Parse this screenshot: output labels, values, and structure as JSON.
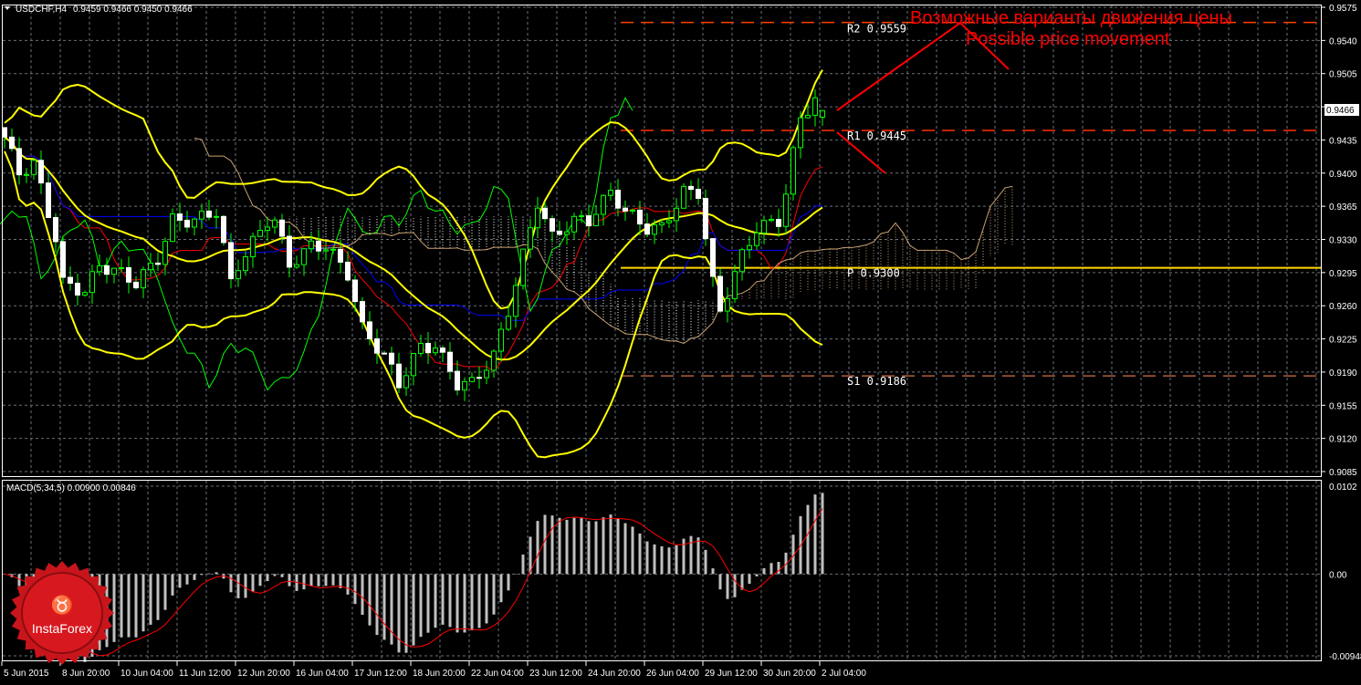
{
  "header": {
    "symbol": "USDCHF,H4",
    "ohlc": "0.9459 0.9466 0.9450 0.9466"
  },
  "macd_header": "MACD(5,34,5) 0.00900 0.00846",
  "price_axis": [
    "0.9575",
    "0.9540",
    "0.9505",
    "0.9470",
    "0.9435",
    "0.9400",
    "0.9365",
    "0.9330",
    "0.9295",
    "0.9260",
    "0.9225",
    "0.9190",
    "0.9155",
    "0.9120",
    "0.9085"
  ],
  "current_price": "0.9466",
  "macd_axis": [
    "0.0102",
    "0.00",
    "-0.00948"
  ],
  "time_axis": [
    "5 Jun 2015",
    "8 Jun 20:00",
    "10 Jun 04:00",
    "11 Jun 12:00",
    "12 Jun 20:00",
    "16 Jun 04:00",
    "17 Jun 12:00",
    "18 Jun 20:00",
    "22 Jun 04:00",
    "23 Jun 12:00",
    "24 Jun 20:00",
    "26 Jun 04:00",
    "29 Jun 12:00",
    "30 Jun 20:00",
    "2 Jul 04:00"
  ],
  "levels": [
    {
      "label": "R2 0.9559",
      "price": 0.9559,
      "color": "#ff4000",
      "style": "dashed"
    },
    {
      "label": "R1 0.9445",
      "price": 0.9445,
      "color": "#ff3000",
      "style": "dashed"
    },
    {
      "label": "P 0.9300",
      "price": 0.93,
      "color": "#ffd700",
      "style": "solid"
    },
    {
      "label": "S1 0.9186",
      "price": 0.9186,
      "color": "#b06040",
      "style": "dashed"
    }
  ],
  "annotation": {
    "ru": "Возможные варианты движения цены",
    "en": "Possible price movement",
    "color": "#ff0000"
  },
  "logo": "InstaForex",
  "chart_data": {
    "type": "candlestick",
    "symbol": "USDCHF",
    "timeframe": "H4",
    "price_range": [
      0.9085,
      0.9575
    ],
    "macd_range": [
      -0.00948,
      0.0102
    ],
    "price_path": [
      [
        0,
        0.9438
      ],
      [
        2,
        0.94
      ],
      [
        4,
        0.941
      ],
      [
        7,
        0.9332
      ],
      [
        8,
        0.9284
      ],
      [
        11,
        0.9275
      ],
      [
        13,
        0.9303
      ],
      [
        16,
        0.9294
      ],
      [
        18,
        0.9284
      ],
      [
        21,
        0.931
      ],
      [
        23,
        0.935
      ],
      [
        26,
        0.935
      ],
      [
        29,
        0.936
      ],
      [
        31,
        0.9284
      ],
      [
        32,
        0.9303
      ],
      [
        36,
        0.935
      ],
      [
        37,
        0.935
      ],
      [
        39,
        0.9303
      ],
      [
        42,
        0.9323
      ],
      [
        44,
        0.9323
      ],
      [
        47,
        0.9294
      ],
      [
        49,
        0.9236
      ],
      [
        52,
        0.9207
      ],
      [
        54,
        0.9178
      ],
      [
        57,
        0.9217
      ],
      [
        59,
        0.9217
      ],
      [
        62,
        0.9178
      ],
      [
        64,
        0.9178
      ],
      [
        67,
        0.9207
      ],
      [
        69,
        0.9255
      ],
      [
        71,
        0.9313
      ],
      [
        73,
        0.937
      ],
      [
        75,
        0.9332
      ],
      [
        78,
        0.935
      ],
      [
        80,
        0.935
      ],
      [
        83,
        0.938
      ],
      [
        85,
        0.936
      ],
      [
        88,
        0.9342
      ],
      [
        90,
        0.9342
      ],
      [
        93,
        0.938
      ],
      [
        95,
        0.938
      ],
      [
        97,
        0.9284
      ],
      [
        98,
        0.9255
      ],
      [
        101,
        0.9313
      ],
      [
        103,
        0.9342
      ],
      [
        106,
        0.935
      ],
      [
        107,
        0.938
      ],
      [
        108,
        0.942
      ],
      [
        109,
        0.9458
      ],
      [
        111,
        0.9478
      ],
      [
        112,
        0.9466
      ]
    ],
    "indicators": [
      "Bollinger Bands(20)",
      "Ichimoku(9,26,52)",
      "MACD(5,34,5)"
    ]
  }
}
